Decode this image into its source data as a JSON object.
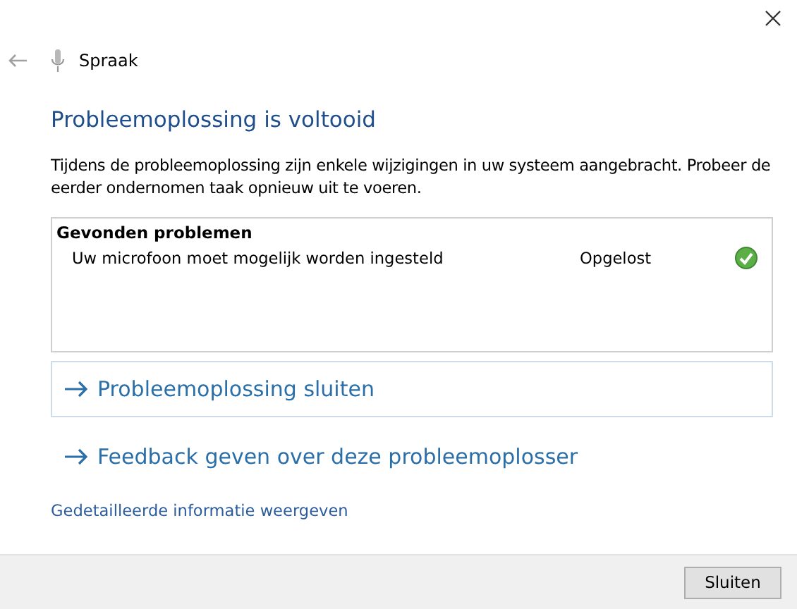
{
  "header": {
    "title": "Spraak"
  },
  "heading": "Probleemoplossing is voltooid",
  "description": "Tijdens de probleemoplossing zijn enkele wijzigingen in uw systeem aangebracht. Probeer de eerder ondernomen taak opnieuw uit te voeren.",
  "problems": {
    "title": "Gevonden problemen",
    "items": [
      {
        "name": "Uw microfoon moet mogelijk worden ingesteld",
        "status": "Opgelost",
        "resolved": true
      }
    ]
  },
  "commands": [
    {
      "label": "Probleemoplossing sluiten",
      "highlighted": true
    },
    {
      "label": "Feedback geven over deze probleemoplosser",
      "highlighted": false
    }
  ],
  "details_link": "Gedetailleerde informatie weergeven",
  "buttons": [
    "Sluiten"
  ]
}
